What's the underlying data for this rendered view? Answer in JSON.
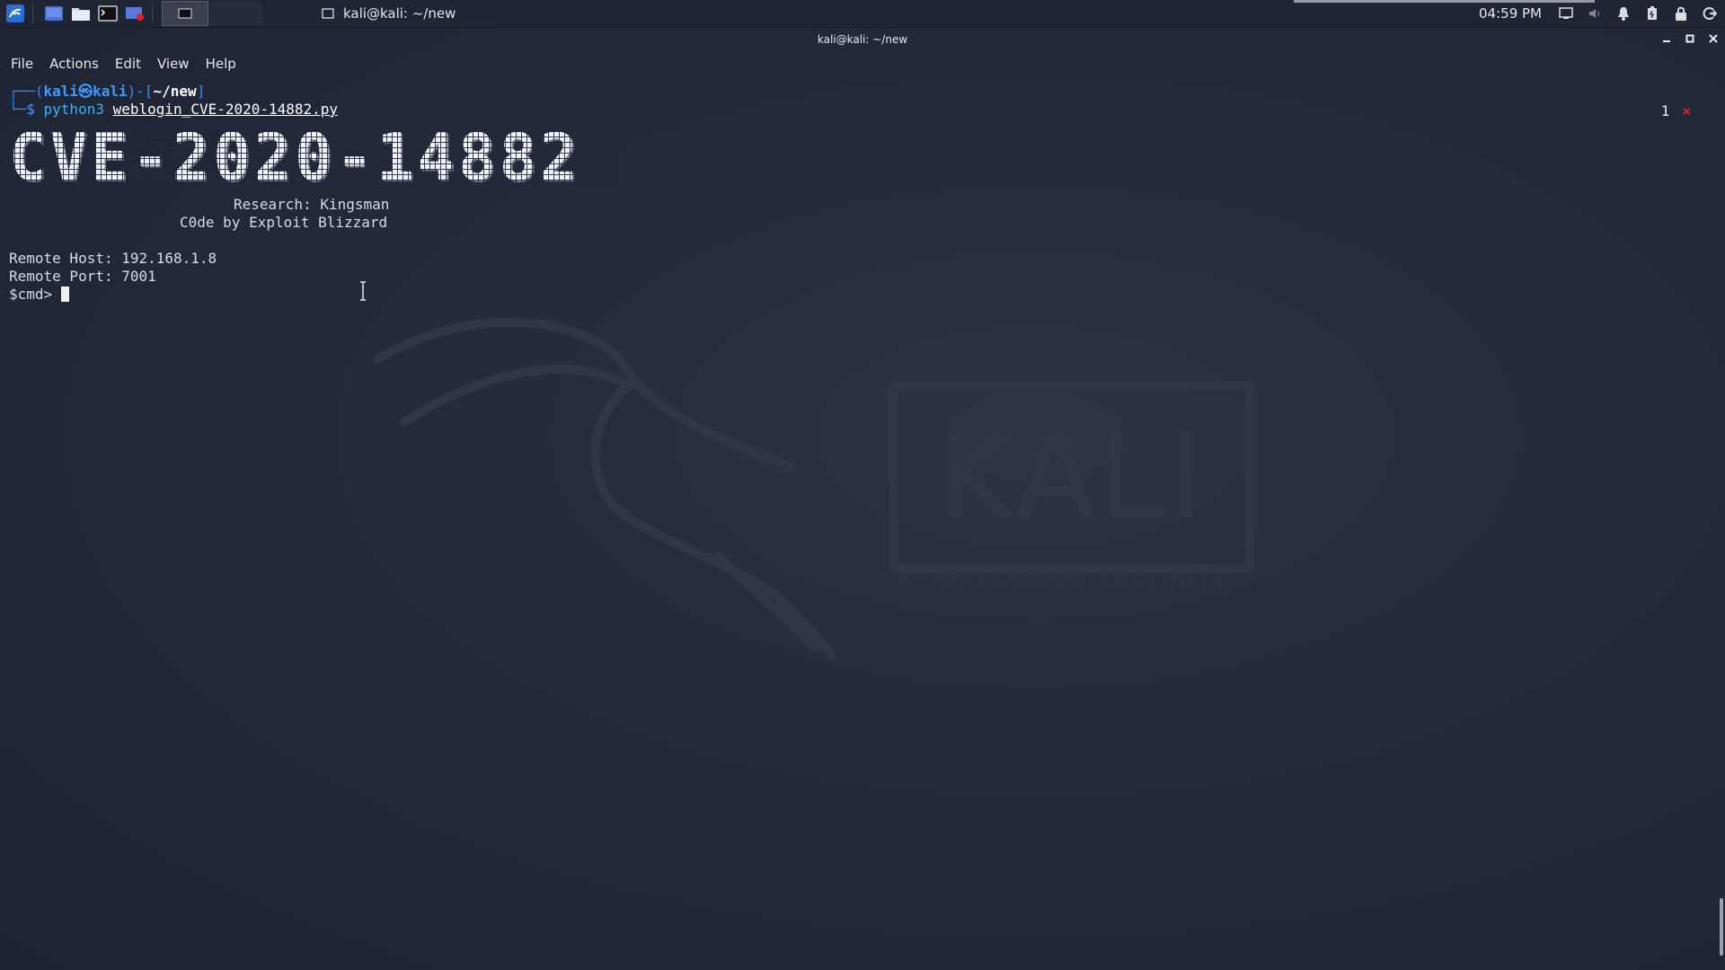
{
  "panel": {
    "taskbar_title": "kali@kali: ~/new",
    "clock": "04:59 PM",
    "icons": [
      "kali-menu-icon",
      "desktop-icon",
      "file-manager-icon",
      "terminal-icon",
      "screenshot-icon"
    ]
  },
  "window": {
    "title": "kali@kali: ~/new"
  },
  "menu": {
    "file": "File",
    "actions": "Actions",
    "edit": "Edit",
    "view": "View",
    "help": "Help"
  },
  "terminal": {
    "prompt_user": "kali",
    "prompt_at": "㉿",
    "prompt_host": "kali",
    "prompt_path": "~/new",
    "cmd_name": "python3",
    "cmd_file": "weblogin_CVE-2020-14882.py",
    "banner": "CVE-2020-14882",
    "research": "Research: Kingsman",
    "code_by": "C0de by Exploit Blizzard",
    "remote_host": "Remote Host: 192.168.1.8",
    "remote_port": "Remote Port: 7001",
    "cmd_prompt": "$cmd>"
  },
  "tab_indicator": {
    "count": "1",
    "close": "×"
  },
  "wallpaper": {
    "logo": "KALI",
    "tagline": "BY OFFENSIVE SECURITY"
  },
  "colors": {
    "background": "#23293a",
    "prompt_blue": "#3c9cff",
    "error_red": "#e0242b"
  }
}
